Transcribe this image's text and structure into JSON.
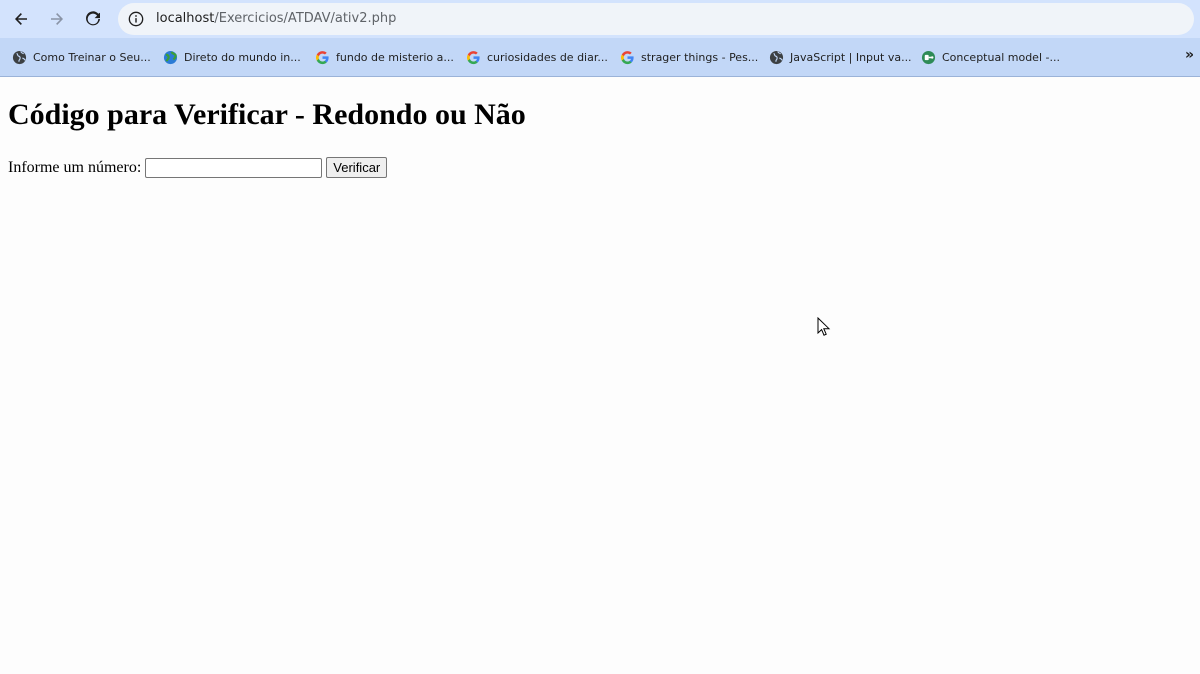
{
  "browser": {
    "url_host": "localhost",
    "url_path": "/Exercicios/ATDAV/ativ2.php",
    "bookmarks": [
      {
        "label": "Como Treinar o Seu...",
        "icon": "globe-icon"
      },
      {
        "label": "Direto do mundo in...",
        "icon": "earth-icon"
      },
      {
        "label": "fundo de misterio a...",
        "icon": "google-icon"
      },
      {
        "label": "curiosidades de diar...",
        "icon": "google-icon"
      },
      {
        "label": "strager things - Pes...",
        "icon": "google-icon"
      },
      {
        "label": "JavaScript | Input va...",
        "icon": "globe-icon"
      },
      {
        "label": "Conceptual model -...",
        "icon": "conceptual-model-icon"
      }
    ],
    "more_label": "»"
  },
  "page": {
    "heading": "Código para Verificar - Redondo ou Não",
    "form": {
      "label": "Informe um número:",
      "input_value": "",
      "button_label": "Verificar"
    }
  },
  "colors": {
    "toolbar_bg": "#d3e3fd",
    "bookmarks_bg": "#c2d7f7",
    "omnibox_bg": "#f0f4f9",
    "page_bg": "#fdfdfd"
  }
}
